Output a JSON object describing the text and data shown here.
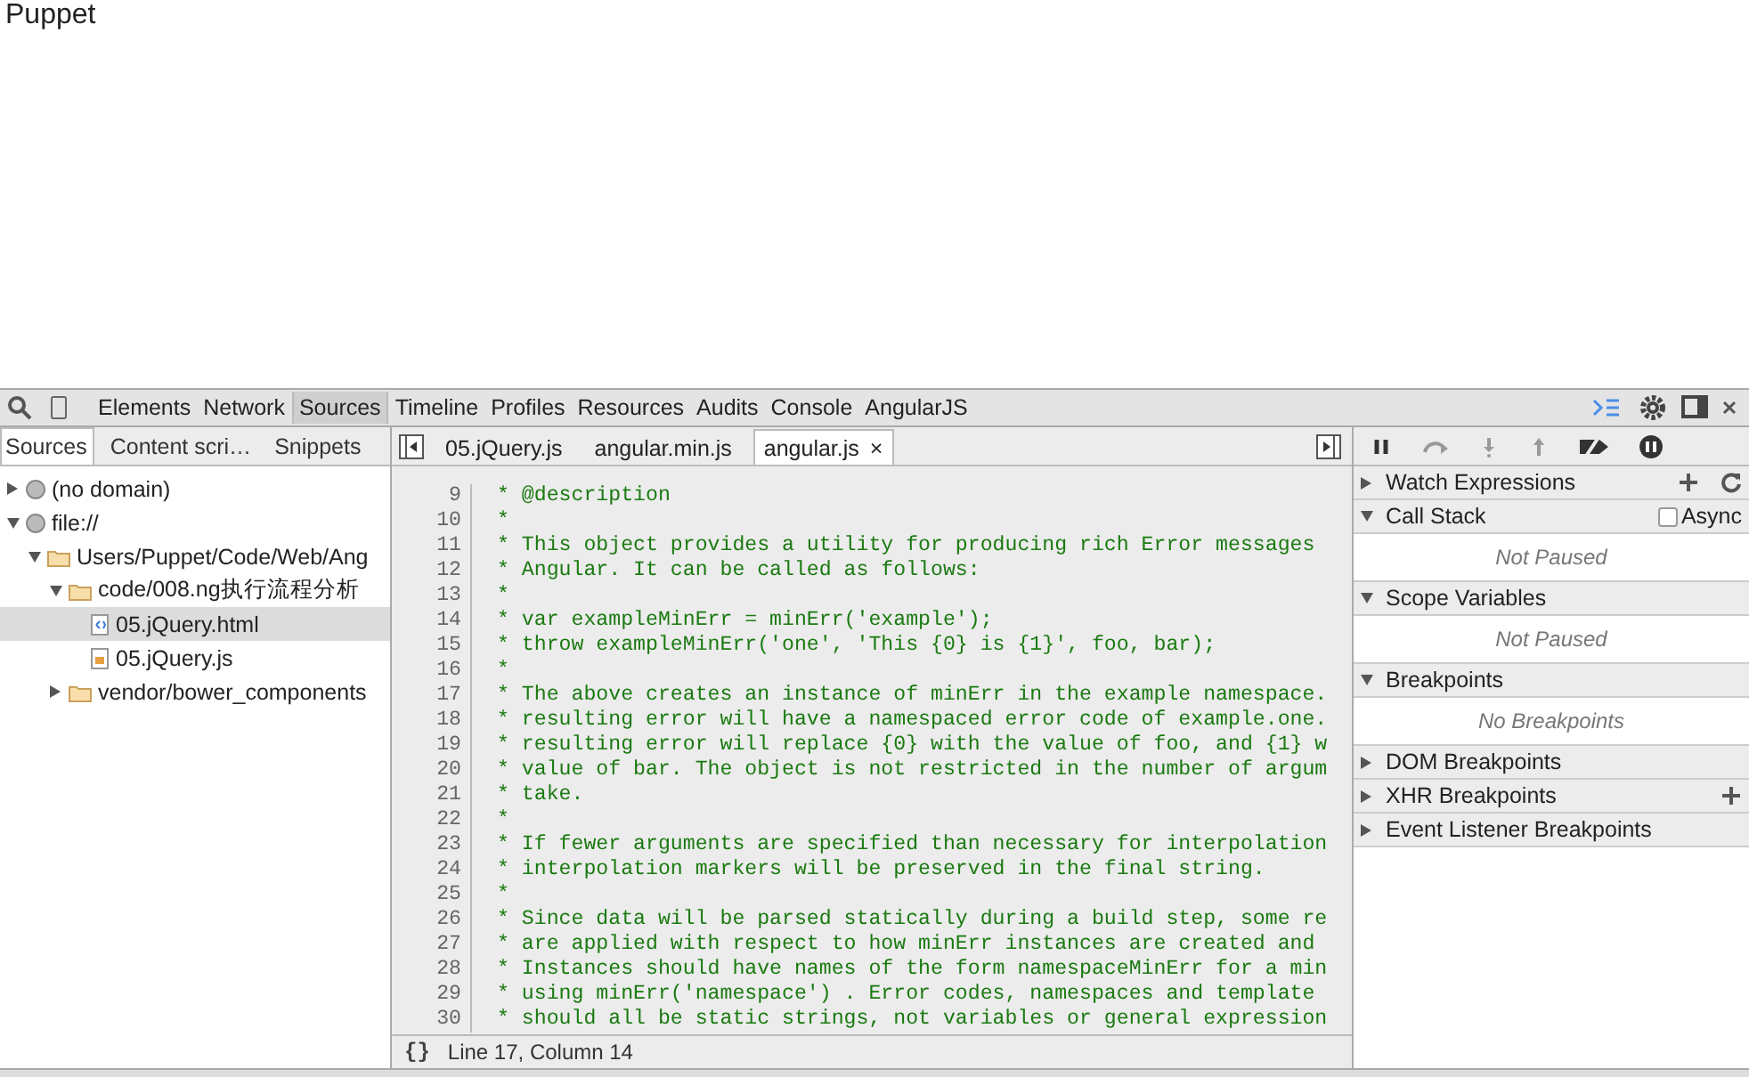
{
  "page": {
    "title": "Puppet"
  },
  "toolbar": {
    "tabs": [
      {
        "label": "Elements",
        "selected": false
      },
      {
        "label": "Network",
        "selected": false
      },
      {
        "label": "Sources",
        "selected": true
      },
      {
        "label": "Timeline",
        "selected": false
      },
      {
        "label": "Profiles",
        "selected": false
      },
      {
        "label": "Resources",
        "selected": false
      },
      {
        "label": "Audits",
        "selected": false
      },
      {
        "label": "Console",
        "selected": false
      },
      {
        "label": "AngularJS",
        "selected": false
      }
    ]
  },
  "sidebar": {
    "tabs": [
      {
        "label": "Sources",
        "selected": true
      },
      {
        "label": "Content scri…",
        "selected": false
      },
      {
        "label": "Snippets",
        "selected": false
      }
    ],
    "tree": [
      {
        "label": "(no domain)",
        "kind": "domain",
        "expanded": false,
        "selected": false
      },
      {
        "label": "file://",
        "kind": "domain",
        "expanded": true,
        "selected": false,
        "children": [
          {
            "label": "Users/Puppet/Code/Web/Ang",
            "kind": "folder",
            "expanded": true,
            "selected": false,
            "children": [
              {
                "label": "code/008.ng执行流程分析",
                "kind": "folder",
                "expanded": true,
                "selected": false,
                "children": [
                  {
                    "label": "05.jQuery.html",
                    "kind": "html",
                    "selected": true
                  },
                  {
                    "label": "05.jQuery.js",
                    "kind": "js",
                    "selected": false
                  }
                ]
              },
              {
                "label": "vendor/bower_components",
                "kind": "folder",
                "expanded": false,
                "selected": false
              }
            ]
          }
        ]
      }
    ]
  },
  "editor": {
    "tabs": [
      {
        "label": "05.jQuery.js",
        "selected": false
      },
      {
        "label": "angular.min.js",
        "selected": false
      },
      {
        "label": "angular.js",
        "selected": true,
        "close": "×"
      }
    ],
    "lines": [
      {
        "number": "9",
        "text": "* @description"
      },
      {
        "number": "10",
        "text": "*"
      },
      {
        "number": "11",
        "text": "* This object provides a utility for producing rich Error messages"
      },
      {
        "number": "12",
        "text": "* Angular. It can be called as follows:"
      },
      {
        "number": "13",
        "text": "*"
      },
      {
        "number": "14",
        "text": "* var exampleMinErr = minErr('example');"
      },
      {
        "number": "15",
        "text": "* throw exampleMinErr('one', 'This {0} is {1}', foo, bar);"
      },
      {
        "number": "16",
        "text": "*"
      },
      {
        "number": "17",
        "text": "* The above creates an instance of minErr in the example namespace."
      },
      {
        "number": "18",
        "text": "* resulting error will have a namespaced error code of example.one."
      },
      {
        "number": "19",
        "text": "* resulting error will replace {0} with the value of foo, and {1} w"
      },
      {
        "number": "20",
        "text": "* value of bar. The object is not restricted in the number of argum"
      },
      {
        "number": "21",
        "text": "* take."
      },
      {
        "number": "22",
        "text": "*"
      },
      {
        "number": "23",
        "text": "* If fewer arguments are specified than necessary for interpolation"
      },
      {
        "number": "24",
        "text": "* interpolation markers will be preserved in the final string."
      },
      {
        "number": "25",
        "text": "*"
      },
      {
        "number": "26",
        "text": "* Since data will be parsed statically during a build step, some re"
      },
      {
        "number": "27",
        "text": "* are applied with respect to how minErr instances are created and"
      },
      {
        "number": "28",
        "text": "* Instances should have names of the form namespaceMinErr for a min"
      },
      {
        "number": "29",
        "text": "* using minErr('namespace') . Error codes, namespaces and template"
      },
      {
        "number": "30",
        "text": "* should all be static strings, not variables or general expression"
      }
    ],
    "status": {
      "pretty_print": "{}",
      "position": "Line 17, Column 14"
    }
  },
  "debugger": {
    "sections": [
      {
        "title": "Watch Expressions",
        "expanded": false,
        "actions": [
          {
            "kind": "add"
          },
          {
            "kind": "refresh"
          }
        ]
      },
      {
        "title": "Call Stack",
        "expanded": true,
        "message": "Not Paused",
        "checkbox": {
          "label": "Async",
          "checked": false
        }
      },
      {
        "title": "Scope Variables",
        "expanded": true,
        "message": "Not Paused"
      },
      {
        "title": "Breakpoints",
        "expanded": true,
        "message": "No Breakpoints"
      },
      {
        "title": "DOM Breakpoints",
        "expanded": false
      },
      {
        "title": "XHR Breakpoints",
        "expanded": false,
        "actions": [
          {
            "kind": "add"
          }
        ]
      },
      {
        "title": "Event Listener Breakpoints",
        "expanded": false
      }
    ]
  }
}
